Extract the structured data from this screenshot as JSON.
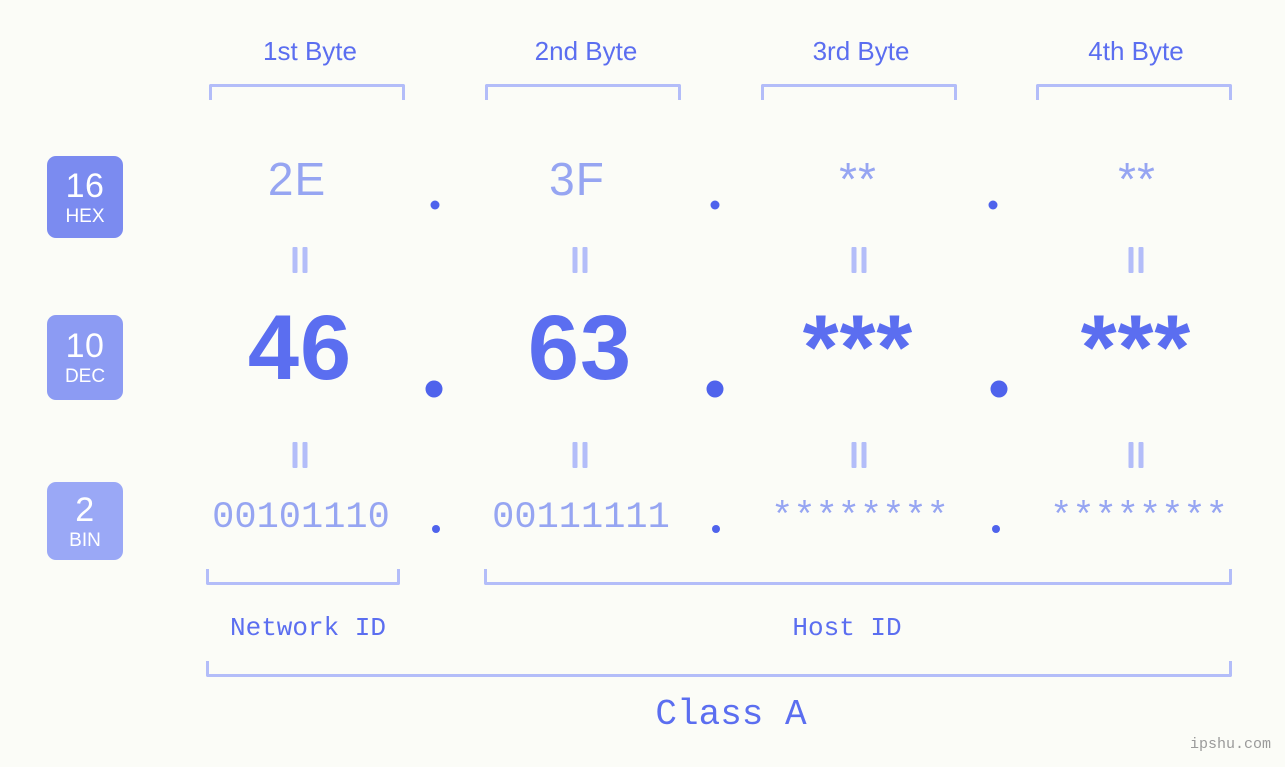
{
  "background_color": "#fbfcf7",
  "accent_color": "#5b6ef0",
  "accent_light_color": "#96a5f2",
  "bracket_color": "#b3bdf9",
  "headers": [
    {
      "label": "1st Byte"
    },
    {
      "label": "2nd Byte"
    },
    {
      "label": "3rd Byte"
    },
    {
      "label": "4th Byte"
    }
  ],
  "rows": {
    "hex": {
      "badge_number": "16",
      "badge_name": "HEX",
      "badge_color": "#7b8bf0",
      "values": [
        "2E",
        "3F",
        "**",
        "**"
      ]
    },
    "dec": {
      "badge_number": "10",
      "badge_name": "DEC",
      "badge_color": "#8c9bf3",
      "values": [
        "46",
        "63",
        "***",
        "***"
      ]
    },
    "bin": {
      "badge_number": "2",
      "badge_name": "BIN",
      "badge_color": "#9aa8f6",
      "values": [
        "00101110",
        "00111111",
        "********",
        "********"
      ]
    }
  },
  "separator": ".",
  "equals_mark": "=",
  "footer": {
    "network_id_label": "Network ID",
    "host_id_label": "Host ID",
    "class_label": "Class A",
    "watermark": "ipshu.com"
  }
}
